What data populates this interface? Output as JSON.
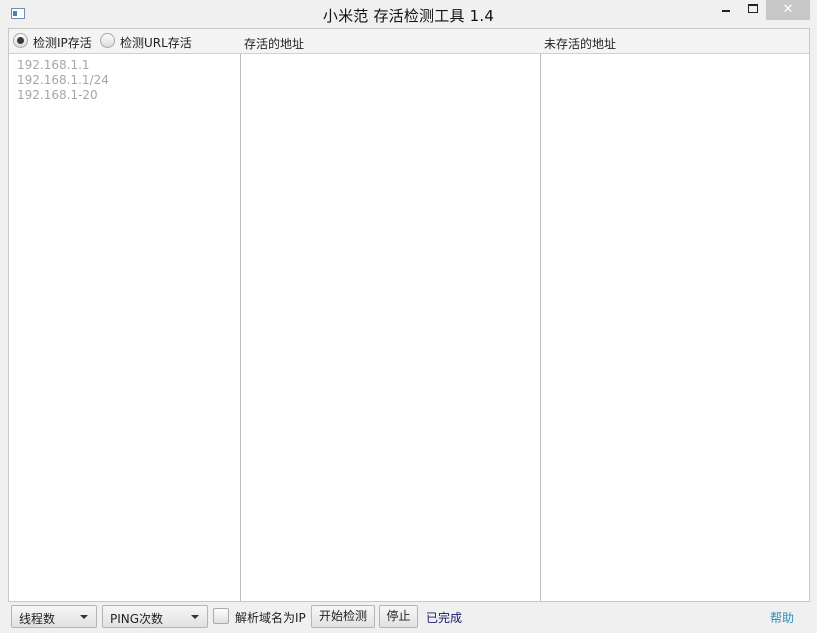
{
  "window": {
    "title": "小米范 存活检测工具 1.4",
    "icon": "app-window-icon",
    "close_glyph": "✕"
  },
  "header": {
    "radio_ip_label": "检测IP存活",
    "radio_url_label": "检测URL存活",
    "selected_mode": "检测IP存活",
    "alive_column_title": "存活的地址",
    "dead_column_title": "未存活的地址"
  },
  "input_panel": {
    "placeholder": "192.168.1.1\n192.168.1.1/24\n192.168.1-20",
    "value": ""
  },
  "alive_panel": {
    "items": []
  },
  "dead_panel": {
    "items": []
  },
  "bottom_bar": {
    "threads_combo": "线程数",
    "ping_combo": "PING次数",
    "resolve_checkbox_label": "解析域名为IP",
    "resolve_checked": false,
    "start_button": "开始检测",
    "stop_button": "停止",
    "status_text": "已完成",
    "help_link": "帮助"
  },
  "colors": {
    "status_text": "#1a1a66",
    "help_link": "#2a8fb8",
    "placeholder": "#a6a6a6"
  }
}
